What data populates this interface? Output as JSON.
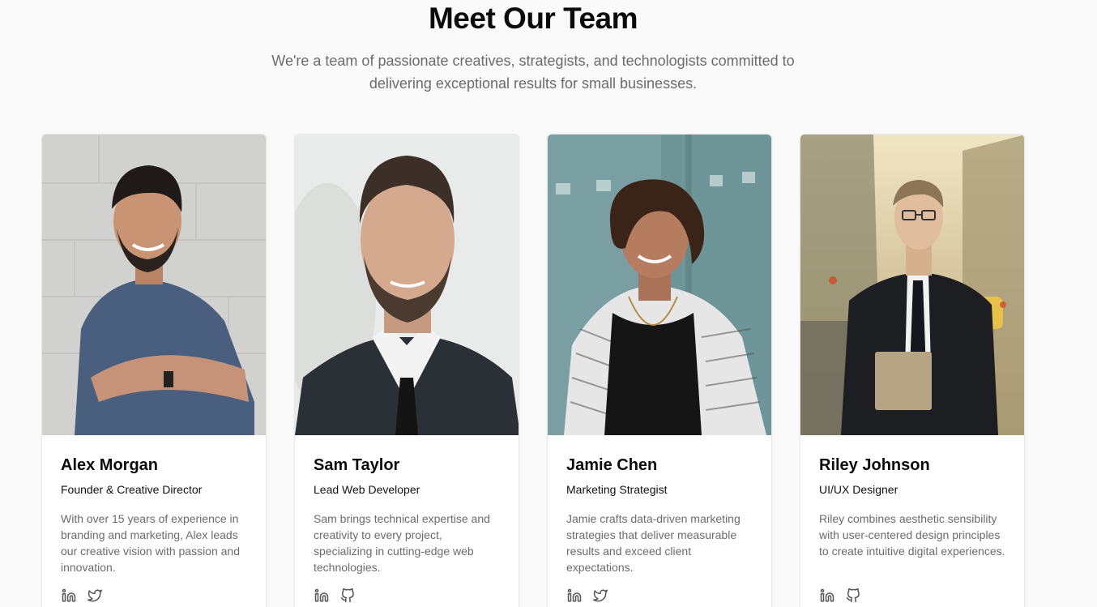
{
  "section": {
    "title": "Meet Our Team",
    "subtitle": "We're a team of passionate creatives, strategists, and technologists committed to delivering exceptional results for small businesses."
  },
  "team": [
    {
      "name": "Alex Morgan",
      "role": "Founder & Creative Director",
      "bio": "With over 15 years of experience in branding and marketing, Alex leads our creative vision with passion and innovation.",
      "photo_icon": "person-photo",
      "socials": [
        "linkedin-icon",
        "twitter-icon"
      ]
    },
    {
      "name": "Sam Taylor",
      "role": "Lead Web Developer",
      "bio": "Sam brings technical expertise and creativity to every project, specializing in cutting-edge web technologies.",
      "photo_icon": "person-photo",
      "socials": [
        "linkedin-icon",
        "github-icon"
      ]
    },
    {
      "name": "Jamie Chen",
      "role": "Marketing Strategist",
      "bio": "Jamie crafts data-driven marketing strategies that deliver measurable results and exceed client expectations.",
      "photo_icon": "person-photo",
      "socials": [
        "linkedin-icon",
        "twitter-icon"
      ]
    },
    {
      "name": "Riley Johnson",
      "role": "UI/UX Designer",
      "bio": "Riley combines aesthetic sensibility with user-centered design principles to create intuitive digital experiences.",
      "photo_icon": "person-photo",
      "socials": [
        "linkedin-icon",
        "github-icon"
      ]
    }
  ],
  "colors": {
    "background": "#fafafa",
    "card": "#ffffff",
    "muted_text": "#6b6b6b",
    "icon": "#555555"
  }
}
